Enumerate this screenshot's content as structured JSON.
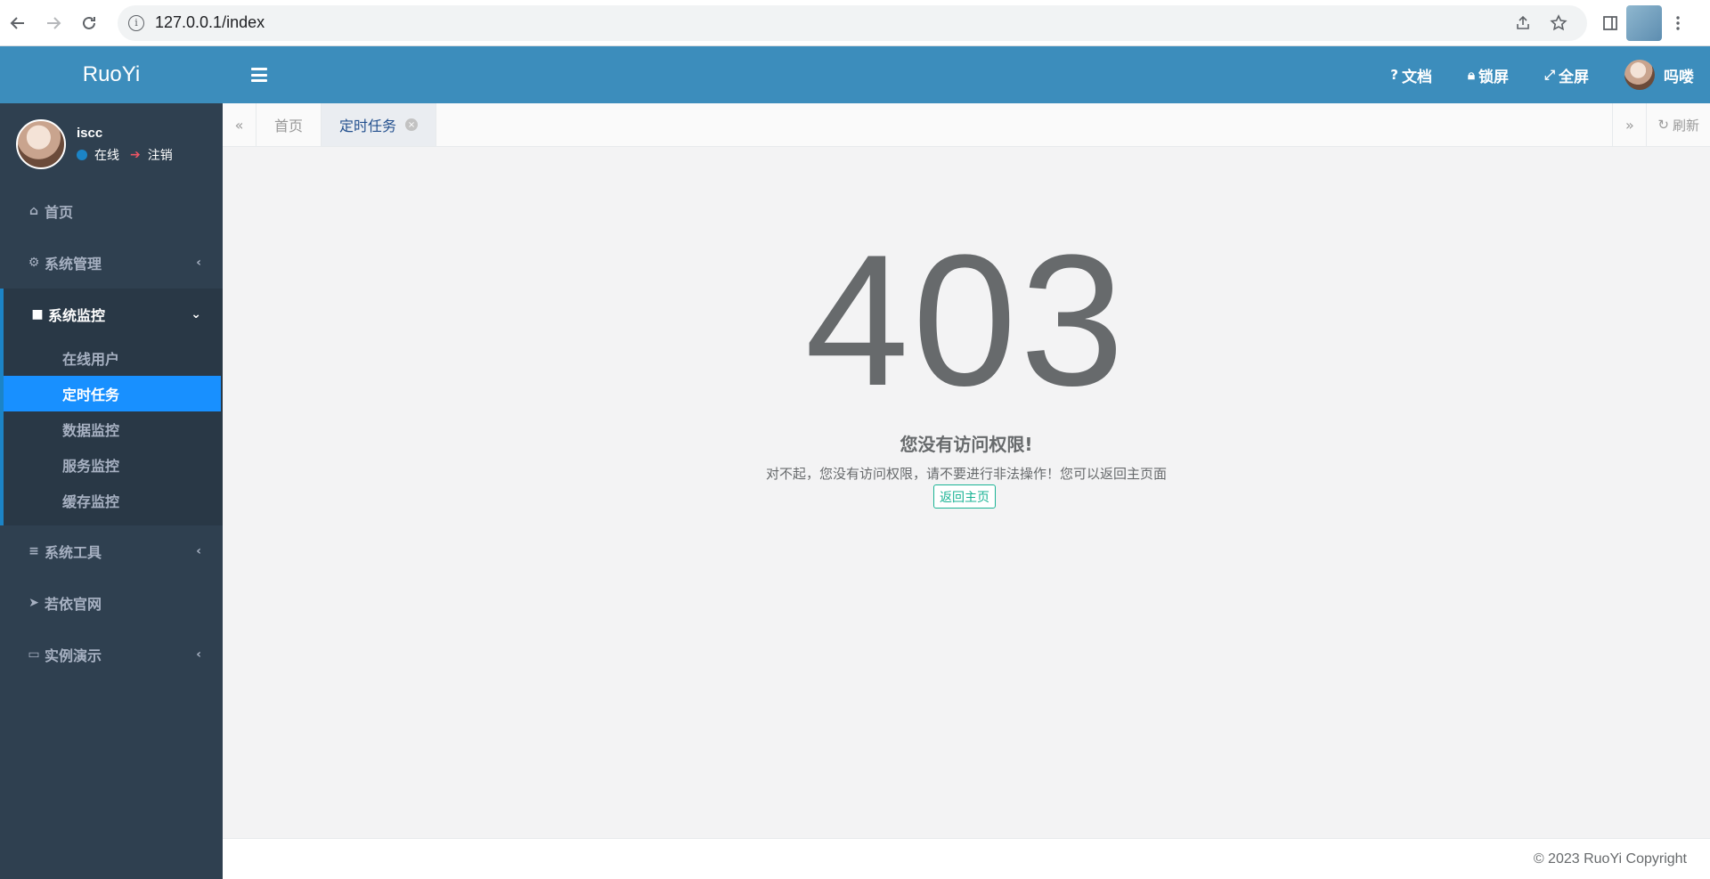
{
  "browser": {
    "url": "127.0.0.1/index"
  },
  "sidebar": {
    "logo": "RuoYi",
    "user": {
      "name": "iscc",
      "status": "在线",
      "logout": "注销"
    },
    "menu": [
      {
        "label": "首页",
        "icon": "home-icon"
      },
      {
        "label": "系统管理",
        "icon": "gear-icon"
      },
      {
        "label": "系统监控",
        "icon": "video-icon",
        "children": [
          "在线用户",
          "定时任务",
          "数据监控",
          "服务监控",
          "缓存监控"
        ]
      },
      {
        "label": "系统工具",
        "icon": "bars-icon"
      },
      {
        "label": "若依官网",
        "icon": "location-arrow-icon"
      },
      {
        "label": "实例演示",
        "icon": "desktop-icon"
      }
    ]
  },
  "topbar": {
    "docs": "文档",
    "lock": "锁屏",
    "fullscreen": "全屏",
    "username": "吗喽"
  },
  "tabs": {
    "items": [
      "首页",
      "定时任务"
    ],
    "refresh": "刷新"
  },
  "content": {
    "code": "403",
    "title": "您没有访问权限!",
    "desc": "对不起，您没有访问权限，请不要进行非法操作！您可以返回主页面",
    "back": "返回主页"
  },
  "footer": {
    "copyright": "© 2023 RuoYi Copyright"
  },
  "colors": {
    "header": "#3c8dbc",
    "sidebar": "#2f4050",
    "active_item": "#1890ff",
    "button_green": "#1ab394"
  }
}
